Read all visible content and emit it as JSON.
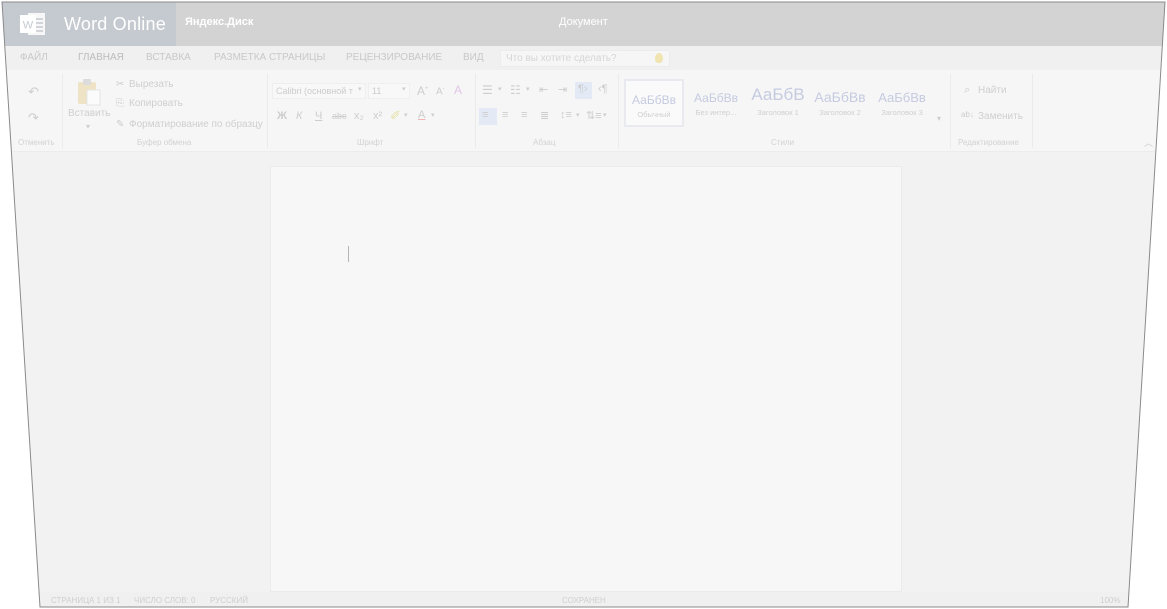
{
  "app": {
    "name": "Word Online",
    "service": "Яндекс.Диск",
    "document_title": "Документ"
  },
  "tabs": [
    "ФАЙЛ",
    "ГЛАВНАЯ",
    "ВСТАВКА",
    "РАЗМЕТКА СТРАНИЦЫ",
    "РЕЦЕНЗИРОВАНИЕ",
    "ВИД"
  ],
  "active_tab": "ГЛАВНАЯ",
  "tell_me": {
    "placeholder": "Что вы хотите сделать?"
  },
  "ribbon": {
    "undo": {
      "label": "Отменить"
    },
    "clipboard": {
      "paste": "Вставить",
      "cut": "Вырезать",
      "copy": "Копировать",
      "format_painter": "Форматирование по образцу",
      "label": "Буфер обмена"
    },
    "font": {
      "name": "Calibri (основной т",
      "size": "11",
      "bold": "Ж",
      "italic": "К",
      "underline": "Ч",
      "strike": "abc",
      "subscript": "x₂",
      "superscript": "x²",
      "font_color": "A",
      "label": "Шрифт"
    },
    "paragraph": {
      "label": "Абзац"
    },
    "styles": {
      "items": [
        {
          "sample": "АаБбВв",
          "name": "Обычный"
        },
        {
          "sample": "АаБбВв",
          "name": "Без интер..."
        },
        {
          "sample": "АаБбВ",
          "name": "Заголовок 1"
        },
        {
          "sample": "АаБбВв",
          "name": "Заголовок 2"
        },
        {
          "sample": "АаБбВв",
          "name": "Заголовок 3"
        }
      ],
      "label": "Стили"
    },
    "editing": {
      "find": "Найти",
      "replace": "Заменить",
      "label": "Редактирование"
    }
  },
  "status": {
    "page": "СТРАНИЦА 1 ИЗ 1",
    "words": "ЧИСЛО СЛОВ: 0",
    "language": "РУССКИЙ",
    "saved": "СОХРАНЕН",
    "zoom": "100%"
  },
  "colors": {
    "brand": "#2b579a",
    "title_bar": "#d3d3d3"
  }
}
